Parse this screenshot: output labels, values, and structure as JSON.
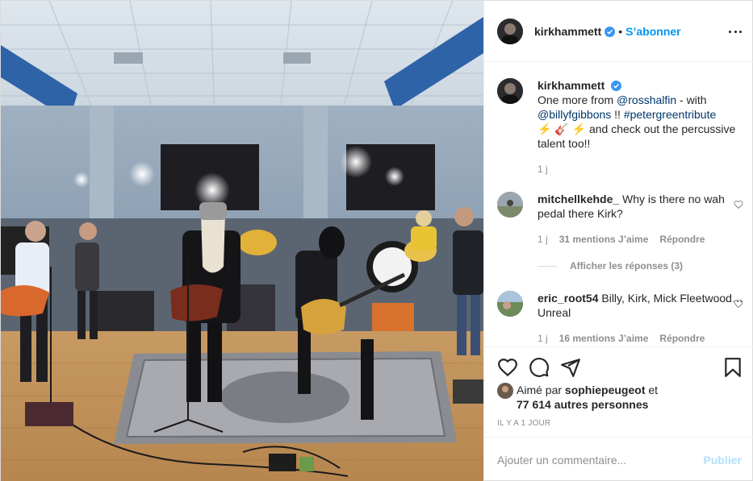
{
  "post": {
    "author": "kirkhammett",
    "follow_label": "S’abonner",
    "separator": "•",
    "more_icon": "more-horizontal-icon"
  },
  "caption": {
    "user": "kirkhammett",
    "text_1": "One more from ",
    "mention_1": "@rosshalfin",
    "text_2": " - with ",
    "mention_2": "@billyfgibbons",
    "text_3": " !! ",
    "hashtag": "#petergreentribute",
    "emoji": "⚡ 🎸 ⚡",
    "text_4": "  and check out the percussive talent too!!",
    "time": "1 j"
  },
  "comments": [
    {
      "user": "mitchellkehde_",
      "text": "Why is there no wah pedal there Kirk?",
      "time": "1 j",
      "likes": "31 mentions J’aime",
      "reply": "Répondre"
    },
    {
      "user": "eric_root54",
      "text": "Billy, Kirk, Mick Fleetwood… Unreal",
      "time": "1 j",
      "likes": "16 mentions J’aime",
      "reply": "Répondre"
    }
  ],
  "view_replies": "Afficher les réponses (3)",
  "liked_by": {
    "prefix": "Aimé par ",
    "user": "sophiepeugeot",
    "mid": " et",
    "count": "77 614 autres personnes"
  },
  "time_ago": "IL Y A 1 JOUR",
  "add_comment": {
    "placeholder": "Ajouter un commentaire...",
    "publish": "Publier"
  },
  "colors": {
    "accent": "#0095f6",
    "publish_disabled": "#b2dffc",
    "link": "#00376b",
    "muted": "#8e8e8e"
  }
}
